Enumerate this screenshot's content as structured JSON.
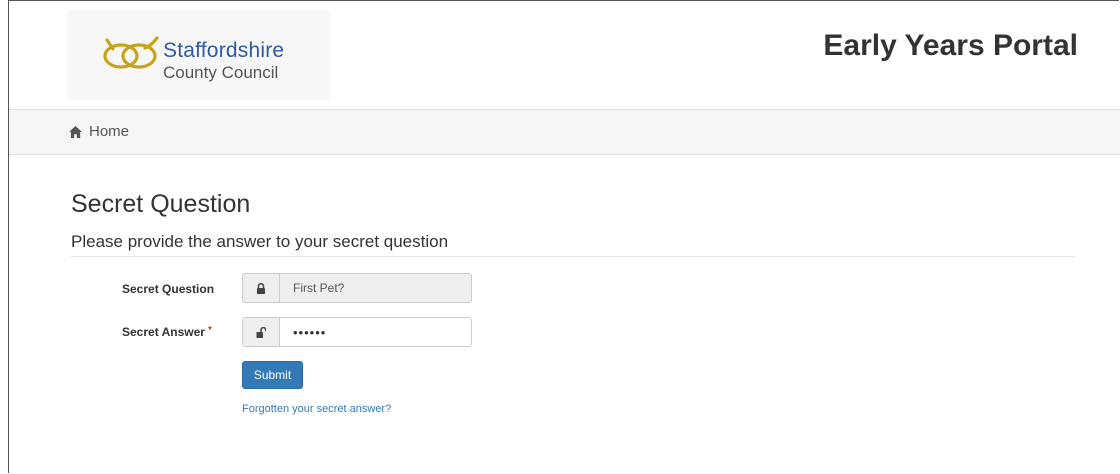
{
  "header": {
    "logo": {
      "line1": "Staffordshire",
      "line2": "County Council",
      "brand_color": "#2d5aa0",
      "knot_color": "#c8a21a"
    },
    "portal_title": "Early Years Portal"
  },
  "nav": {
    "home_icon": "home-icon",
    "home_label": "Home"
  },
  "main": {
    "heading": "Secret Question",
    "subheading": "Please provide the answer to your secret question",
    "form": {
      "question_label": "Secret Question",
      "question_icon": "lock-icon",
      "question_value": "First Pet?",
      "answer_label": "Secret Answer",
      "answer_required_marker": "*",
      "answer_icon": "unlock-icon",
      "answer_value": "••••••",
      "submit_label": "Submit",
      "forgot_link": "Forgotten your secret answer?"
    }
  },
  "colors": {
    "primary": "#337ab7",
    "required": "#c9302c",
    "navbar_bg": "#f5f5f5"
  }
}
